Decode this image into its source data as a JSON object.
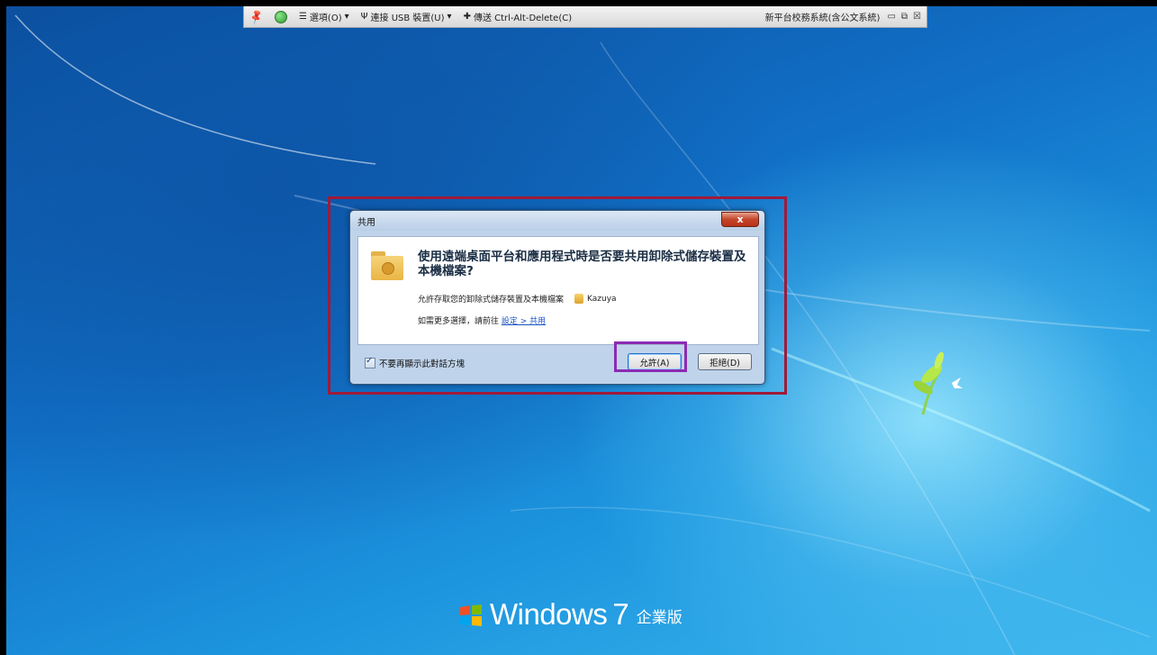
{
  "toolbar": {
    "options_label": "選項(O)",
    "usb_label": "連接 USB 裝置(U)",
    "send_cad_label": "傳送 Ctrl-Alt-Delete(C)",
    "session_title": "新平台校務系統(含公文系統)"
  },
  "dialog": {
    "title": "共用",
    "close_glyph": "x",
    "headline": "使用遠端桌面平台和應用程式時是否要共用卸除式儲存裝置及本機檔案?",
    "line1_text": "允許存取您的卸除式儲存裝置及本機檔案",
    "user_name": "Kazuya",
    "line2_prefix": "如需更多選擇，請前往",
    "line2_link": "設定 > 共用",
    "checkbox_label": "不要再顯示此對話方塊",
    "allow_button": "允許(A)",
    "deny_button": "拒絕(D)"
  },
  "desktop": {
    "brand_word": "Windows",
    "brand_version": "7",
    "brand_edition": "企業版"
  },
  "colors": {
    "highlight_red": "#a01a3a",
    "highlight_purple": "#8c2bb4"
  }
}
